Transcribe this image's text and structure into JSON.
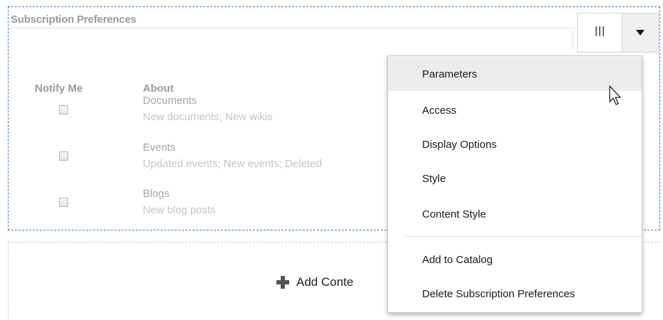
{
  "portlet": {
    "title": "Subscription Preferences",
    "columns": {
      "notify_me": "Notify Me",
      "about": "About"
    },
    "subscriptions": [
      {
        "name": "Documents",
        "description": "New documents; New wikis",
        "checked": false
      },
      {
        "name": "Events",
        "description": "Updated events; New events; Deleted",
        "checked": false
      },
      {
        "name": "Blogs",
        "description": "New blog posts",
        "checked": false
      }
    ]
  },
  "toolbar": {
    "columns_icon": "column-layout-icon",
    "dropdown_icon": "caret-down-icon"
  },
  "menu": {
    "items": [
      {
        "label": "Parameters"
      },
      {
        "label": "Access"
      },
      {
        "label": "Display Options"
      },
      {
        "label": "Style"
      },
      {
        "label": "Content Style"
      },
      {
        "label": "Add to Catalog"
      },
      {
        "label": "Delete Subscription Preferences"
      }
    ],
    "hovered_item": "Parameters"
  },
  "add_content": {
    "label": "Add Conte",
    "icon": "plus-icon"
  },
  "colors": {
    "portlet_border": "#2f7bc4",
    "menu_hover": "#ececec"
  }
}
